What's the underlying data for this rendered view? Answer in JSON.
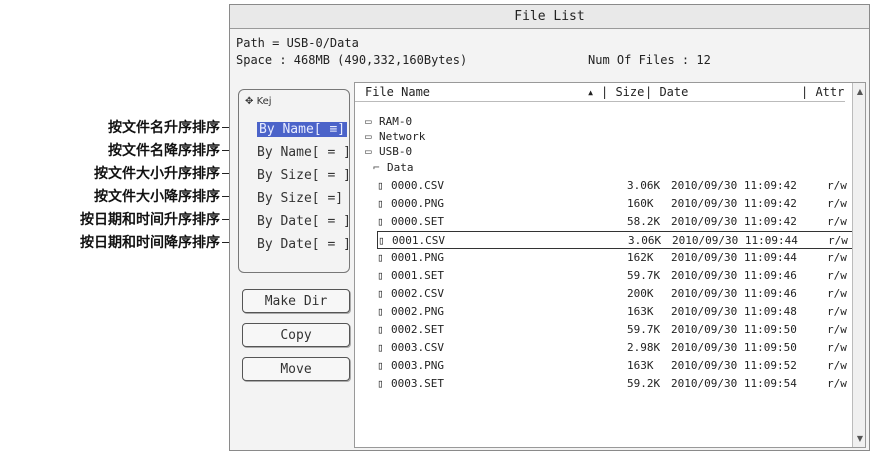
{
  "window": {
    "title": "File List"
  },
  "info": {
    "path": "Path = USB-0/Data",
    "space": "Space : 468MB (490,332,160Bytes)",
    "num_files": "Num Of Files : 12"
  },
  "sort": {
    "icon_label": "Kej",
    "items": [
      {
        "label": "By Name[ ≡]",
        "active": true
      },
      {
        "label": "By Name[ = ]"
      },
      {
        "label": "By Size[ = ]"
      },
      {
        "label": "By Size[ =]"
      },
      {
        "label": "By Date[ = ]"
      },
      {
        "label": "By Date[ = ]"
      }
    ]
  },
  "buttons": {
    "make_dir": "Make Dir",
    "copy": "Copy",
    "move": "Move"
  },
  "columns": {
    "name": "File Name",
    "size": "Size",
    "date": "Date",
    "attr": "Attr"
  },
  "tree": [
    "RAM-0",
    "Network",
    "USB-0",
    "Data"
  ],
  "files": [
    {
      "name": "0000.CSV",
      "size": "3.06K",
      "date": "2010/09/30 11:09:42",
      "attr": "r/w"
    },
    {
      "name": "0000.PNG",
      "size": "160K",
      "date": "2010/09/30 11:09:42",
      "attr": "r/w"
    },
    {
      "name": "0000.SET",
      "size": "58.2K",
      "date": "2010/09/30 11:09:42",
      "attr": "r/w"
    },
    {
      "name": "0001.CSV",
      "size": "3.06K",
      "date": "2010/09/30 11:09:44",
      "attr": "r/w",
      "selected": true
    },
    {
      "name": "0001.PNG",
      "size": "162K",
      "date": "2010/09/30 11:09:44",
      "attr": "r/w"
    },
    {
      "name": "0001.SET",
      "size": "59.7K",
      "date": "2010/09/30 11:09:46",
      "attr": "r/w"
    },
    {
      "name": "0002.CSV",
      "size": "200K",
      "date": "2010/09/30 11:09:46",
      "attr": "r/w"
    },
    {
      "name": "0002.PNG",
      "size": "163K",
      "date": "2010/09/30 11:09:48",
      "attr": "r/w"
    },
    {
      "name": "0002.SET",
      "size": "59.7K",
      "date": "2010/09/30 11:09:50",
      "attr": "r/w"
    },
    {
      "name": "0003.CSV",
      "size": "2.98K",
      "date": "2010/09/30 11:09:50",
      "attr": "r/w"
    },
    {
      "name": "0003.PNG",
      "size": "163K",
      "date": "2010/09/30 11:09:52",
      "attr": "r/w"
    },
    {
      "name": "0003.SET",
      "size": "59.2K",
      "date": "2010/09/30 11:09:54",
      "attr": "r/w"
    }
  ],
  "annotations": [
    "按文件名升序排序",
    "按文件名降序排序",
    "按文件大小升序排序",
    "按文件大小降序排序",
    "按日期和时间升序排序",
    "按日期和时间降序排序"
  ]
}
